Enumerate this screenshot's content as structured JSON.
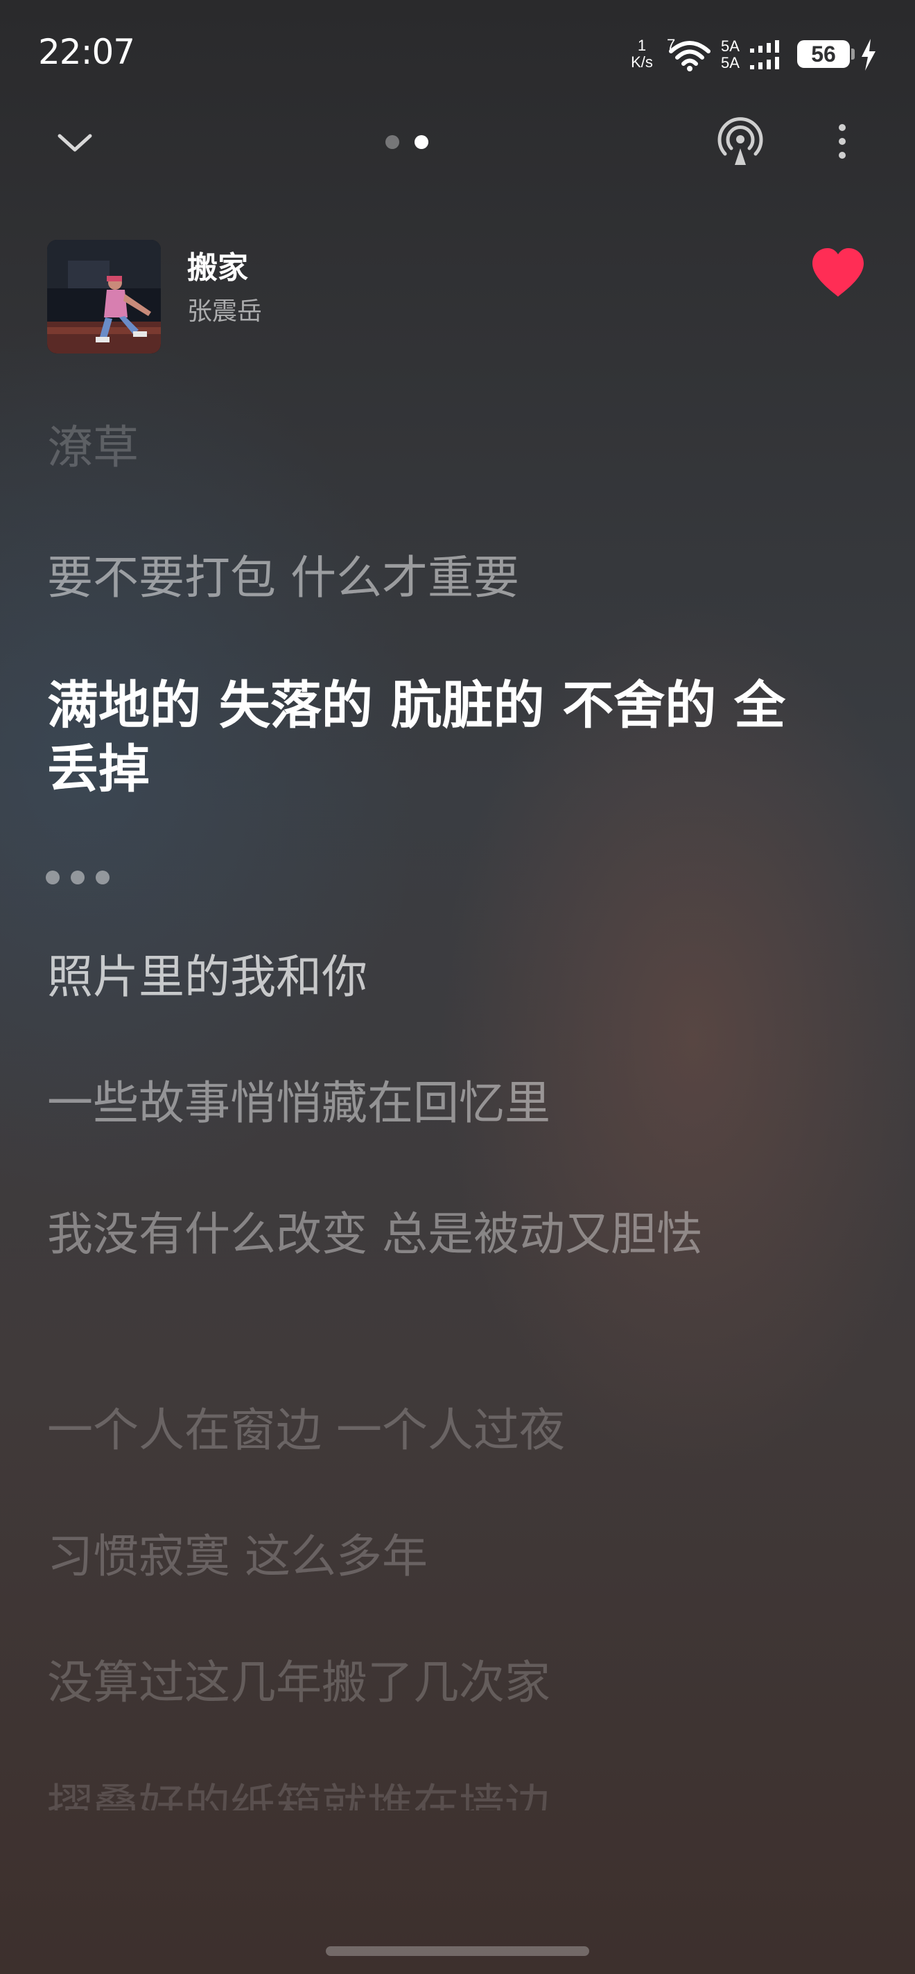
{
  "status_bar": {
    "time": "22:07",
    "net_speed_value": "1",
    "net_speed_unit": "K/s",
    "wifi_badge": "7",
    "signal_1": "5A",
    "signal_2": "5A",
    "battery_level": "56",
    "icons": [
      "wifi-icon",
      "signal-icon",
      "battery-icon",
      "charging-icon"
    ]
  },
  "top_bar": {
    "icons": [
      "chevron-down-icon",
      "cast-icon",
      "more-vertical-icon"
    ],
    "pages": [
      {
        "active": false
      },
      {
        "active": true
      }
    ]
  },
  "song": {
    "title": "搬家",
    "artist": "张震岳",
    "liked": true,
    "like_color": "#ff2d55"
  },
  "lyrics": {
    "lines": [
      {
        "text": "潦草",
        "state": "past-faded"
      },
      {
        "text": "要不要打包 什么才重要",
        "state": "past"
      },
      {
        "text": "满地的 失落的 肮脏的 不舍的 全丢掉",
        "state": "current"
      },
      {
        "text": "照片里的我和你",
        "state": "upcoming"
      },
      {
        "text": "一些故事悄悄藏在回忆里",
        "state": "upcoming"
      },
      {
        "text": "我没有什么改变 总是被动又胆怯",
        "state": "upcoming"
      },
      {
        "text": "一个人在窗边 一个人过夜",
        "state": "upcoming-faded"
      },
      {
        "text": "习惯寂寞 这么多年",
        "state": "upcoming-faded"
      },
      {
        "text": "没算过这几年搬了几次家",
        "state": "upcoming-faded"
      },
      {
        "text": "摺叠好的纸箱就堆在墙边",
        "state": "upcoming-cut"
      }
    ]
  },
  "colors": {
    "accent": "#ff2d55",
    "text_primary": "#ffffff",
    "text_dim": "rgba(255,255,255,0.5)"
  }
}
